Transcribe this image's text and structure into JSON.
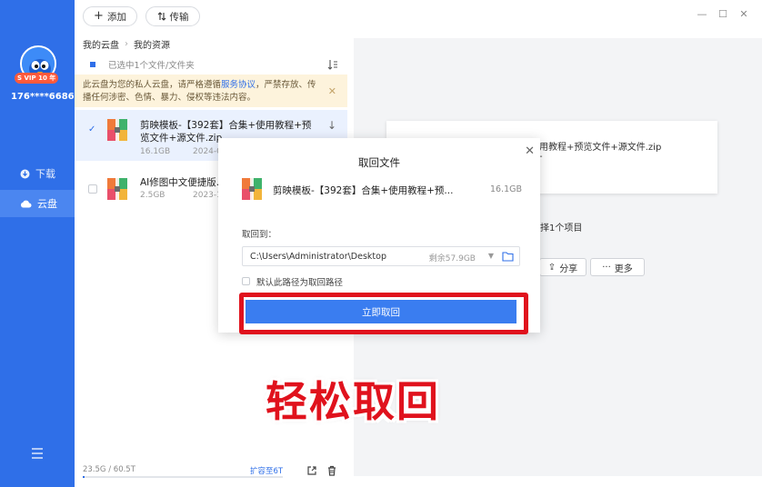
{
  "sidebar": {
    "vip_badge": "S VIP 10 年",
    "user_id": "176****6686",
    "nav": [
      {
        "label": "下载",
        "icon": "download-icon"
      },
      {
        "label": "云盘",
        "icon": "cloud-icon"
      }
    ]
  },
  "toolbar": {
    "add_label": "添加",
    "transfer_label": "传输",
    "window_controls": [
      "minimize",
      "maximize",
      "close"
    ]
  },
  "breadcrumb": [
    "我的云盘",
    "我的资源"
  ],
  "selection": {
    "text": "已选中1个文件/文件夹"
  },
  "notice": {
    "text_before": "此云盘为您的私人云盘，请严格遵循",
    "link": "服务协议",
    "text_after": "，严禁存放、传播任何涉密、色情、暴力、侵权等违法内容。"
  },
  "files": [
    {
      "name_line1": "剪映模板-【392套】合集+使用教程+预",
      "name_line2": "览文件+源文件.zip",
      "size": "16.1GB",
      "date": "2024-0",
      "selected": true
    },
    {
      "name_line1": "AI修图中文便捷版.z",
      "name_line2": "",
      "size": "2.5GB",
      "date": "2023-1",
      "selected": false
    }
  ],
  "storage": {
    "usage": "23.5G / 60.5T",
    "used_fraction": 0.0004,
    "expand_label": "扩容至6T"
  },
  "preview": {
    "name_line1": "用教程+预览文件+源文件.zip",
    "name_line2": "-",
    "selection_text": "择1个项目",
    "share_label": "分享",
    "more_label": "更多"
  },
  "modal": {
    "title": "取回文件",
    "file_name": "剪映模板-【392套】合集+使用教程+预...",
    "file_size": "16.1GB",
    "retrieve_to_label": "取回到：",
    "path": "C:\\Users\\Administrator\\Desktop",
    "free_space": "剩余57.9GB",
    "default_path_label": "默认此路径为取回路径",
    "confirm_label": "立即取回"
  },
  "caption": "轻松取回",
  "colors": {
    "brand": "#2f6fe8",
    "highlight_red": "#e0121d",
    "notice_bg": "#fdf3dc"
  }
}
